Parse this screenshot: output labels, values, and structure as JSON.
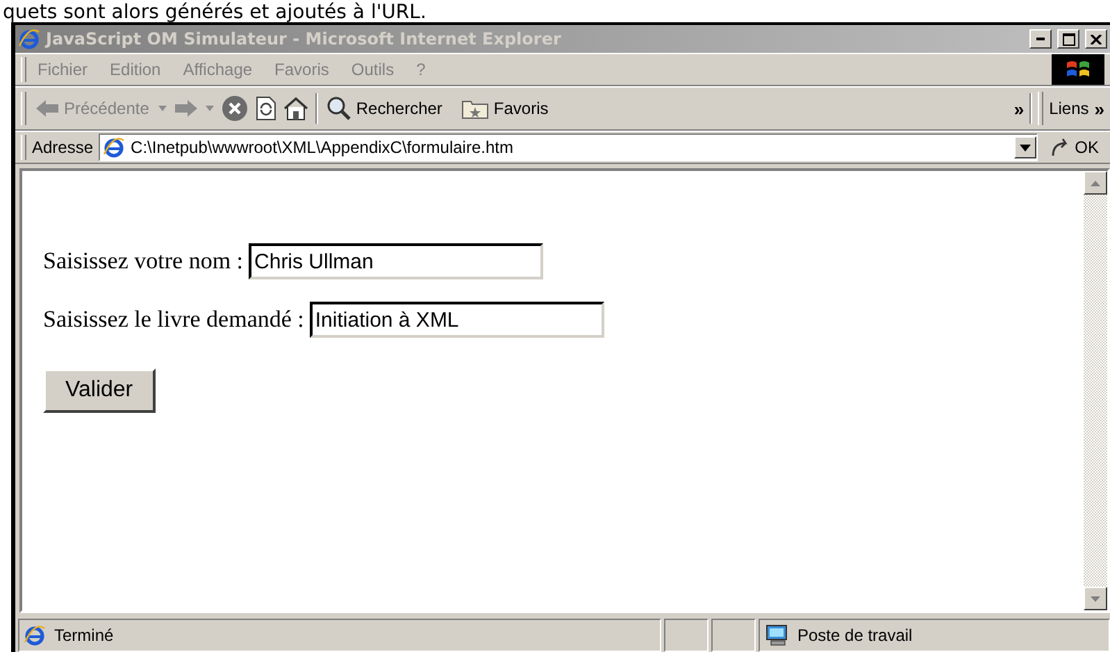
{
  "caption": "quets sont alors générés et ajoutés à l'URL.",
  "window": {
    "title": "JavaScript OM Simulateur - Microsoft Internet Explorer",
    "active": false
  },
  "menu": [
    "Fichier",
    "Edition",
    "Affichage",
    "Favoris",
    "Outils",
    "?"
  ],
  "toolbar": {
    "back": "Précédente",
    "search": "Rechercher",
    "favorites": "Favoris",
    "chevron": "»",
    "links": "Liens",
    "links_chevron": "»"
  },
  "address": {
    "label": "Adresse",
    "value": "C:\\Inetpub\\wwwroot\\XML\\AppendixC\\formulaire.htm",
    "go": "OK"
  },
  "form": {
    "fields": [
      {
        "label": "Saisissez votre nom :",
        "value": "Chris Ullman"
      },
      {
        "label": "Saisissez le livre demandé :",
        "value": "Initiation à XML"
      }
    ],
    "submit": "Valider"
  },
  "status_bar": {
    "text": "Terminé",
    "zone": "Poste de travail"
  }
}
